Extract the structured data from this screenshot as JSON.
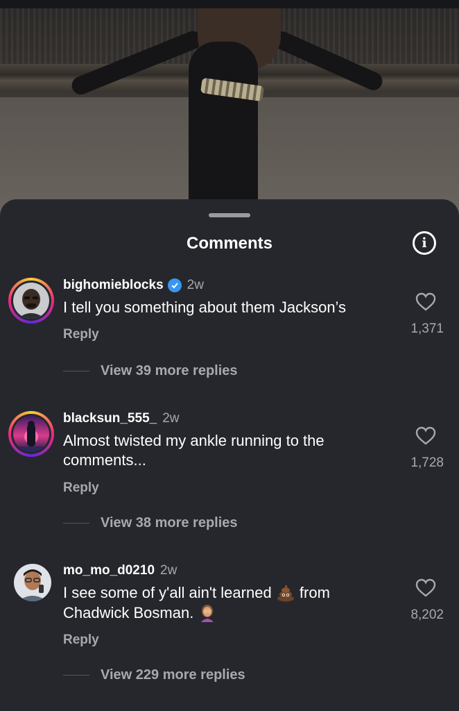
{
  "sheet": {
    "title": "Comments",
    "info_icon": "info-icon"
  },
  "comments": [
    {
      "username": "bighomieblocks",
      "verified": true,
      "time": "2w",
      "text": "I tell you something about them Jackson’s",
      "reply_label": "Reply",
      "likes": "1,371",
      "view_replies": "View 39 more replies"
    },
    {
      "username": "blacksun_555_",
      "verified": false,
      "time": "2w",
      "text": "Almost twisted my ankle running to the comments...",
      "reply_label": "Reply",
      "likes": "1,728",
      "view_replies": "View 38 more replies"
    },
    {
      "username": "mo_mo_d0210",
      "verified": false,
      "time": "2w",
      "text_parts": [
        "I see some of y'all ain't learned ",
        " from Chadwick Bosman. "
      ],
      "emojis": [
        "poop-emoji",
        "facepalm-emoji"
      ],
      "reply_label": "Reply",
      "likes": "8,202",
      "view_replies": "View 229 more replies"
    }
  ],
  "colors": {
    "sheet_bg": "#26272c",
    "secondary_text": "#a8a8ad",
    "verified_blue": "#3897f0"
  }
}
